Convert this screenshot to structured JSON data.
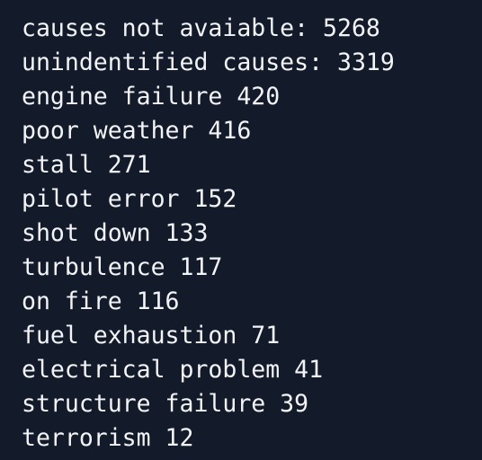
{
  "terminal": {
    "background": "#131a29",
    "text_color": "#f2f4f7",
    "lines": [
      "causes not avaiable: 5268",
      "unindentified causes: 3319",
      "engine failure 420",
      "poor weather 416",
      "stall 271",
      "pilot error 152",
      "shot down 133",
      "turbulence 117",
      "on fire 116",
      "fuel exhaustion 71",
      "electrical problem 41",
      "structure failure 39",
      "terrorism 12"
    ]
  }
}
